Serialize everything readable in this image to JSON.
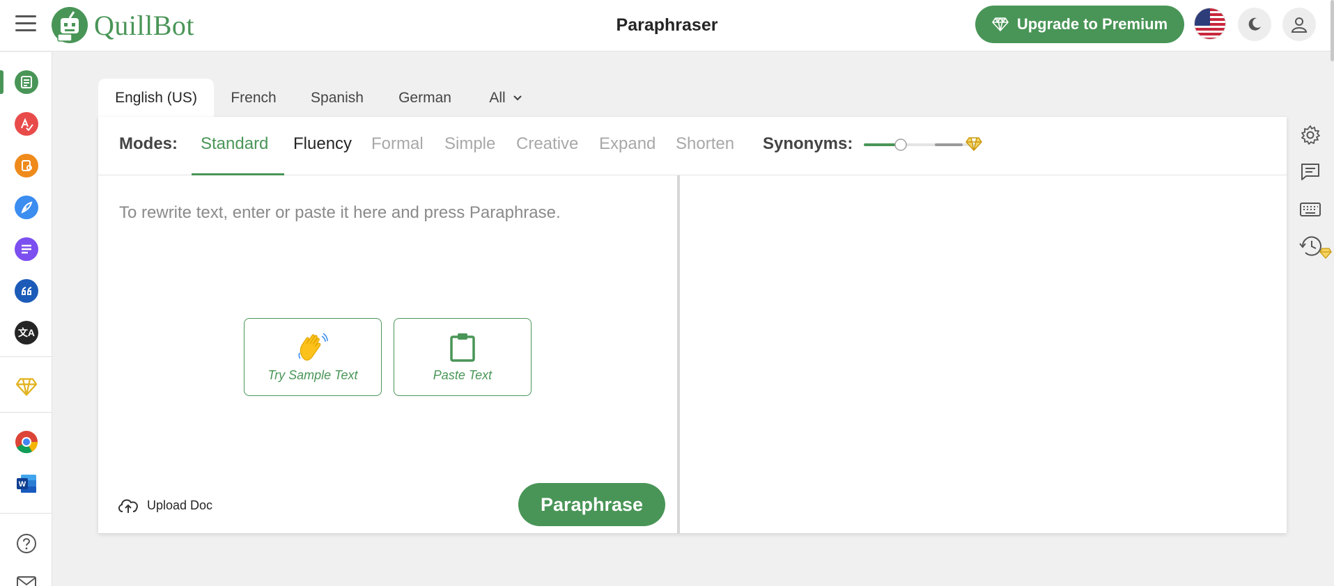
{
  "header": {
    "logo_text": "QuillBot",
    "title": "Paraphraser",
    "upgrade_label": "Upgrade to Premium"
  },
  "languages": [
    "English (US)",
    "French",
    "Spanish",
    "German",
    "All"
  ],
  "modes": {
    "label": "Modes:",
    "items": [
      "Standard",
      "Fluency",
      "Formal",
      "Simple",
      "Creative",
      "Expand",
      "Shorten"
    ],
    "active": "Standard",
    "synonyms_label": "Synonyms:",
    "synonyms_level": 0.33
  },
  "editor": {
    "placeholder": "To rewrite text, enter or paste it here and press Paraphrase.",
    "sample_label": "Try Sample Text",
    "paste_label": "Paste Text",
    "upload_label": "Upload Doc",
    "paraphrase_label": "Paraphrase"
  },
  "colors": {
    "brand_green": "#499557",
    "premium_gold": "#E2B423"
  },
  "icons": {
    "sidebar": [
      "paraphraser-icon",
      "grammar-checker-icon",
      "plagiarism-checker-icon",
      "co-writer-icon",
      "summarizer-icon",
      "citation-generator-icon",
      "translator-icon",
      "premium-diamond-icon",
      "chrome-extension-icon",
      "word-addin-icon",
      "help-icon",
      "mail-icon"
    ],
    "side_tools": [
      "settings-gear-icon",
      "feedback-icon",
      "keyboard-icon",
      "history-icon"
    ]
  }
}
